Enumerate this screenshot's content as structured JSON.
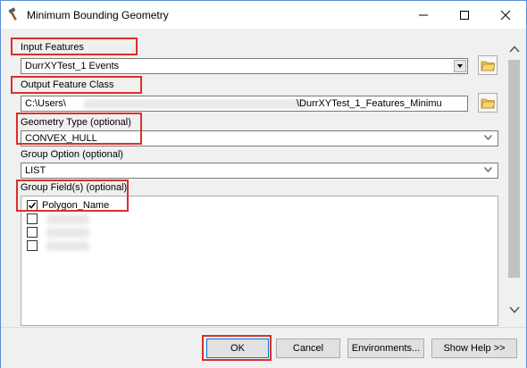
{
  "window": {
    "title": "Minimum Bounding Geometry",
    "icon": "hammer-icon"
  },
  "form": {
    "input_features": {
      "label": "Input Features",
      "value": "DurrXYTest_1 Events"
    },
    "output_feature_class": {
      "label": "Output Feature Class",
      "value_prefix": "C:\\Users\\",
      "value_suffix": "\\DurrXYTest_1_Features_Minimu"
    },
    "geometry_type": {
      "label": "Geometry Type (optional)",
      "value": "CONVEX_HULL"
    },
    "group_option": {
      "label": "Group Option (optional)",
      "value": "LIST"
    },
    "group_fields": {
      "label": "Group Field(s) (optional)",
      "items": [
        {
          "label": "Polygon_Name",
          "checked": true
        },
        {
          "label": "",
          "checked": false
        },
        {
          "label": "",
          "checked": false
        },
        {
          "label": "",
          "checked": false
        }
      ]
    }
  },
  "buttons": {
    "ok": "OK",
    "cancel": "Cancel",
    "environments": "Environments...",
    "show_help": "Show Help >>"
  },
  "colors": {
    "highlight_box": "#d9302b",
    "window_border": "#5b8fd6"
  }
}
